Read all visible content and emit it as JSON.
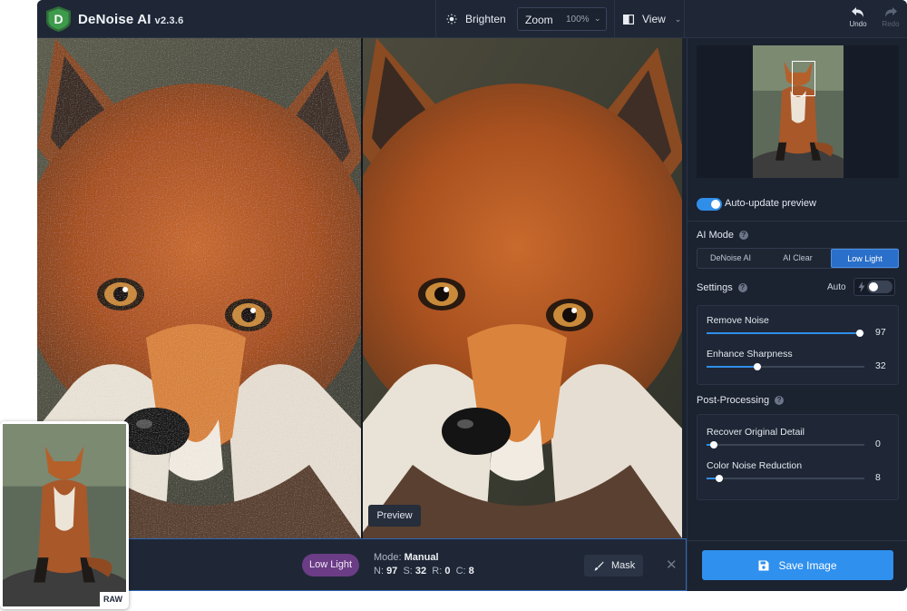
{
  "app": {
    "name": "DeNoise AI",
    "version": "v2.3.6"
  },
  "toolbar": {
    "brighten_label": "Brighten",
    "zoom_label": "Zoom",
    "zoom_value": "100%",
    "view_label": "View",
    "undo_label": "Undo",
    "redo_label": "Redo"
  },
  "preview": {
    "tag_label": "Preview"
  },
  "bottom_bar": {
    "model_pill": "Low Light",
    "mode_label": "Mode:",
    "mode_value": "Manual",
    "params": {
      "n_label": "N:",
      "n_value": "97",
      "s_label": "S:",
      "s_value": "32",
      "r_label": "R:",
      "r_value": "0",
      "c_label": "C:",
      "c_value": "8"
    },
    "mask_label": "Mask",
    "close_symbol": "✕"
  },
  "panel": {
    "auto_update": {
      "label": "Auto-update preview",
      "enabled": true
    },
    "ai_mode": {
      "title": "AI Mode",
      "options": [
        "DeNoise AI",
        "AI Clear",
        "Low Light"
      ],
      "selected_index": 2
    },
    "settings": {
      "title": "Settings",
      "auto_label": "Auto",
      "auto_enabled": false,
      "sliders": [
        {
          "label": "Remove Noise",
          "value": "97",
          "percent": 97
        },
        {
          "label": "Enhance Sharpness",
          "value": "32",
          "percent": 32
        }
      ]
    },
    "post_processing": {
      "title": "Post-Processing",
      "sliders": [
        {
          "label": "Recover Original Detail",
          "value": "0",
          "percent": 0
        },
        {
          "label": "Color Noise Reduction",
          "value": "8",
          "percent": 8
        }
      ]
    },
    "save_label": "Save Image"
  },
  "raw_thumbnail": {
    "tag": "RAW"
  },
  "colors": {
    "accent": "#2f8ee8",
    "panel_bg": "#1b2230",
    "low_light_pill": "#6b3d86"
  },
  "icons": [
    "denoise-logo-icon",
    "brighten-sun-icon",
    "chevron-down-icon",
    "view-split-icon",
    "undo-arrow-icon",
    "redo-arrow-icon",
    "help-icon",
    "lightning-icon",
    "brush-icon",
    "close-icon",
    "save-disk-icon"
  ]
}
